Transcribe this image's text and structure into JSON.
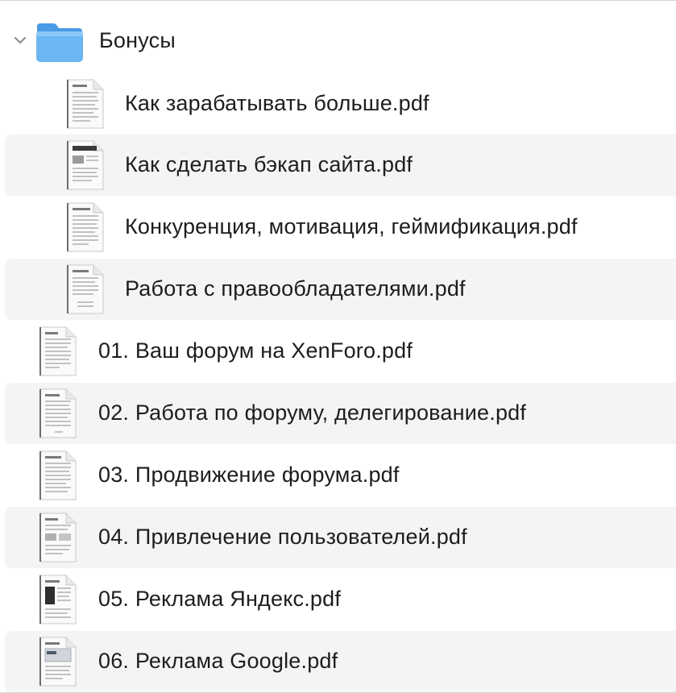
{
  "folder": {
    "name": "Бонусы",
    "expanded": true,
    "icon": "folder-icon",
    "chevron_icon": "chevron-down-icon",
    "children": [
      {
        "name": "Как зарабатывать больше.pdf",
        "icon": "pdf-document-icon"
      },
      {
        "name": "Как сделать бэкап сайта.pdf",
        "icon": "pdf-document-icon"
      },
      {
        "name": "Конкуренция, мотивация, геймификация.pdf",
        "icon": "pdf-document-icon"
      },
      {
        "name": "Работа с правообладателями.pdf",
        "icon": "pdf-document-icon"
      }
    ]
  },
  "files": [
    {
      "name": "01. Ваш форум на XenForo.pdf",
      "icon": "pdf-document-icon"
    },
    {
      "name": "02. Работа по форуму, делегирование.pdf",
      "icon": "pdf-document-icon"
    },
    {
      "name": "03. Продвижение форума.pdf",
      "icon": "pdf-document-icon"
    },
    {
      "name": "04. Привлечение пользователей.pdf",
      "icon": "pdf-document-icon"
    },
    {
      "name": "05. Реклама Яндекс.pdf",
      "icon": "pdf-document-icon"
    },
    {
      "name": "06. Реклама Google.pdf",
      "icon": "pdf-document-icon"
    }
  ],
  "colors": {
    "stripe": "#f4f4f6",
    "folder_blue": "#5aa9ee",
    "text": "#1d1d1f"
  }
}
